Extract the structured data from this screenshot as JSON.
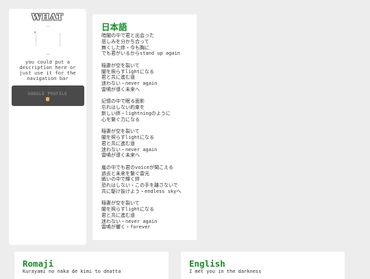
{
  "sidebar": {
    "title": "WHAT",
    "description": "you could put a description here or just use it for the navigation bar",
    "button_label": "GOOGLE PROFILE"
  },
  "japanese": {
    "title": "日本語",
    "stanzas": [
      [
        "暗闇の中で君と出会った",
        "悲しみを分かち合って",
        "無くした絆・今も胸に",
        "でも君がいるからstand up again"
      ],
      [
        "稲妻が空を裂いて",
        "闇を照らすlightになる",
        "君と共に進む道",
        "迷わない・never again",
        "雷鳴が導く未来へ"
      ],
      [
        "記憶の中で眠る面影",
        "忘れはしない約束を",
        "新しい絆・lightningのように",
        "心を繋ぐ力になる"
      ],
      [
        "稲妻が空を裂いて",
        "闇を照らすlightになる",
        "君と共に進む道",
        "迷わない・never again",
        "雷鳴が導く未来へ"
      ],
      [
        "嵐の中でも君のvoiceが聞こえる",
        "過去と未来を繋ぐ雷光",
        "戦いの中で輝く絆",
        "恐れはしない・この手を離さないで",
        "共に駆け抜けよう・endless skyへ"
      ],
      [
        "稲妻が空を裂いて",
        "闇を照らすlightになる",
        "君と共に進む道",
        "迷わない・never again",
        "雷鳴が響く・forever"
      ]
    ]
  },
  "romaji": {
    "title": "Romaji",
    "first_line": "Kurayami no naka de kimi to deatta"
  },
  "english": {
    "title": "English",
    "first_line": "I met you in the darkness"
  }
}
